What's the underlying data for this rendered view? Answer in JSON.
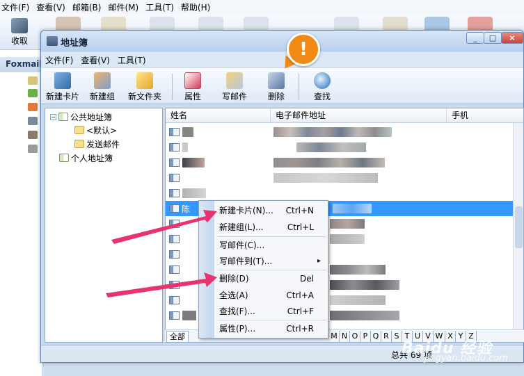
{
  "bg": {
    "menu": [
      "文件(F)",
      "查看(V)",
      "邮箱(B)",
      "邮件(M)",
      "工具(T)",
      "帮助(H)"
    ],
    "receive_label": "收取",
    "foxmail_label": "Foxmail"
  },
  "window": {
    "title": "地址簿",
    "min": "0",
    "max": "1",
    "close": "r"
  },
  "menu": [
    "文件(F)",
    "查看(V)",
    "工具(T)"
  ],
  "toolbar": {
    "new_card": "新建卡片",
    "new_group": "新建组",
    "new_folder": "新文件夹",
    "properties": "属性",
    "write_mail": "写邮件",
    "delete": "删除",
    "find": "查找"
  },
  "tree": {
    "public": "公共地址簿",
    "default": "<默认>",
    "sent": "发送邮件",
    "personal": "个人地址簿"
  },
  "list": {
    "headers": [
      "姓名",
      "电子邮件地址",
      "手机"
    ],
    "selected_name": "陈"
  },
  "alpha_tabs": [
    "全部",
    "M",
    "N",
    "O",
    "P",
    "Q",
    "R",
    "S",
    "T",
    "U",
    "V",
    "W",
    "X",
    "Y",
    "Z"
  ],
  "status": {
    "count": "总共 69 项"
  },
  "context_menu": [
    {
      "label": "新建卡片(N)...",
      "key": "Ctrl+N"
    },
    {
      "label": "新建组(L)...",
      "key": "Ctrl+L"
    },
    {
      "label": "写邮件(C)...",
      "key": ""
    },
    {
      "label": "写邮件到(T)...",
      "key": "▸"
    },
    {
      "label": "删除(D)",
      "key": "Del"
    },
    {
      "label": "全选(A)",
      "key": "Ctrl+A"
    },
    {
      "label": "查找(F)...",
      "key": "Ctrl+F"
    },
    {
      "label": "属性(P)...",
      "key": "Ctrl+R"
    }
  ],
  "badge": "!",
  "watermark": "Baidu 经验",
  "watermark_url": "jingyan.baidu.com",
  "colors": {
    "arrow": "#e8336e",
    "badge": "#f08a14",
    "selection": "#3399ff"
  }
}
